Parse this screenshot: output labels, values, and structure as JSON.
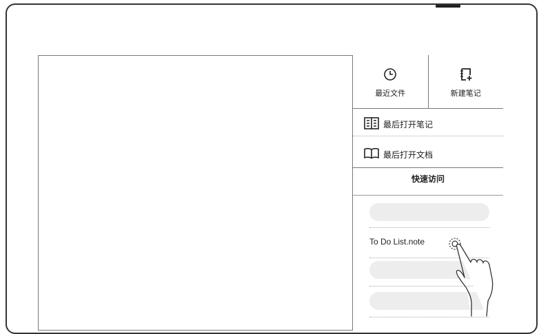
{
  "panel": {
    "tiles": [
      {
        "label": "最近文件",
        "icon": "clock-icon"
      },
      {
        "label": "新建笔记",
        "icon": "new-note-icon"
      }
    ],
    "rows": [
      {
        "label": "最后打开笔记",
        "icon": "notebook-icon"
      },
      {
        "label": "最后打开文档",
        "icon": "open-book-icon"
      }
    ],
    "quick_access": {
      "title": "快速访问",
      "items": [
        "",
        "To Do List.note",
        "",
        ""
      ]
    }
  },
  "gesture": {
    "icon": "tapping-hand-icon"
  }
}
